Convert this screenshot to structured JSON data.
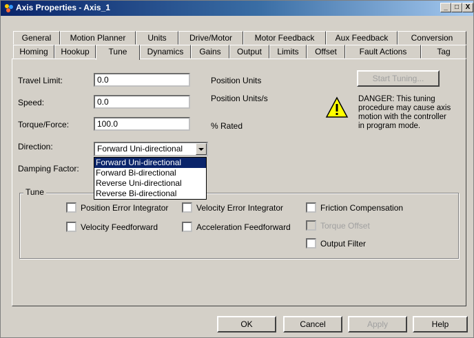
{
  "window": {
    "title": "Axis Properties - Axis_1",
    "minimize": "_",
    "maximize": "□",
    "close": "X"
  },
  "tabs_back": [
    "General",
    "Motion Planner",
    "Units",
    "Drive/Motor",
    "Motor Feedback",
    "Aux Feedback",
    "Conversion"
  ],
  "tabs_front": [
    "Homing",
    "Hookup",
    "Tune",
    "Dynamics",
    "Gains",
    "Output",
    "Limits",
    "Offset",
    "Fault Actions",
    "Tag"
  ],
  "active_tab": "Tune",
  "form": {
    "travel_limit_label": "Travel Limit:",
    "travel_limit_value": "0.0",
    "travel_limit_unit": "Position Units",
    "speed_label": "Speed:",
    "speed_value": "0.0",
    "speed_unit": "Position Units/s",
    "torque_label": "Torque/Force:",
    "torque_value": "100.0",
    "torque_unit": "% Rated",
    "direction_label": "Direction:",
    "direction_value": "Forward Uni-directional",
    "damping_label": "Damping Factor:",
    "direction_options": [
      "Forward Uni-directional",
      "Forward Bi-directional",
      "Reverse Uni-directional",
      "Reverse Bi-directional"
    ]
  },
  "start_tuning": "Start Tuning...",
  "warning_icon": "warning-icon",
  "warning_text": [
    "DANGER: This tuning",
    "procedure may cause axis",
    "motion with the controller",
    "in program mode."
  ],
  "tune_group": {
    "title": "Tune",
    "checks": [
      {
        "label": "Position Error Integrator",
        "checked": false,
        "disabled": false
      },
      {
        "label": "Velocity Error Integrator",
        "checked": false,
        "disabled": false
      },
      {
        "label": "Friction Compensation",
        "checked": false,
        "disabled": false
      },
      {
        "label": "Velocity Feedforward",
        "checked": false,
        "disabled": false
      },
      {
        "label": "Acceleration Feedforward",
        "checked": false,
        "disabled": false
      },
      {
        "label": "Torque Offset",
        "checked": false,
        "disabled": true
      },
      {
        "label": "Output Filter",
        "checked": false,
        "disabled": false
      }
    ]
  },
  "buttons": {
    "ok": "OK",
    "cancel": "Cancel",
    "apply": "Apply",
    "help": "Help"
  },
  "colors": {
    "title_bar": "#0a246a",
    "dialog_face": "#d4d0c8",
    "selection": "#0a246a",
    "warning_yellow": "#ffff00"
  }
}
